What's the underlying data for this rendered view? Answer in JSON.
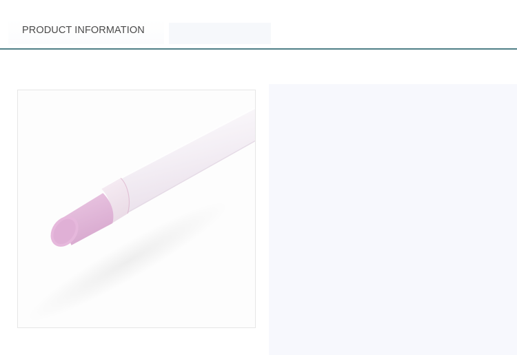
{
  "header": {
    "title": "PRODUCT INFORMATION"
  },
  "colors": {
    "rule": "#4f7f86",
    "panel": "#f7f8fd",
    "stone_tip": "#e2b9da",
    "handle": "#f6f2f7"
  },
  "product_image": {
    "subject": "pink-stone-cuticle-pusher-icon"
  }
}
